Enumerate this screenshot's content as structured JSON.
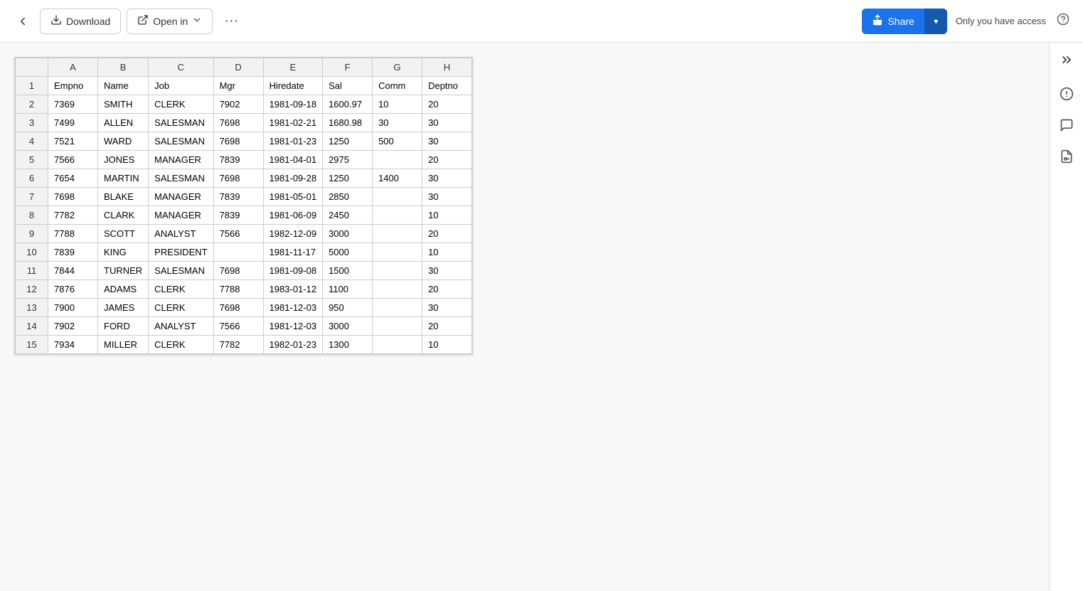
{
  "toolbar": {
    "back_label": "←",
    "download_label": "Download",
    "open_in_label": "Open in",
    "more_label": "•••",
    "share_label": "Share",
    "access_text": "Only you have access",
    "download_icon": "⬇",
    "open_in_icon": "↗",
    "share_icon": "↑"
  },
  "spreadsheet": {
    "col_headers": [
      "",
      "A",
      "B",
      "C",
      "D",
      "E",
      "F",
      "G",
      "H"
    ],
    "rows": [
      {
        "row": 1,
        "cells": [
          "Empno",
          "Name",
          "Job",
          "Mgr",
          "Hiredate",
          "Sal",
          "Comm",
          "Deptno"
        ]
      },
      {
        "row": 2,
        "cells": [
          "7369",
          "SMITH",
          "CLERK",
          "7902",
          "1981-09-18",
          "1600.97",
          "10",
          "20"
        ]
      },
      {
        "row": 3,
        "cells": [
          "7499",
          "ALLEN",
          "SALESMAN",
          "7698",
          "1981-02-21",
          "1680.98",
          "30",
          "30"
        ]
      },
      {
        "row": 4,
        "cells": [
          "7521",
          "WARD",
          "SALESMAN",
          "7698",
          "1981-01-23",
          "1250",
          "500",
          "30"
        ]
      },
      {
        "row": 5,
        "cells": [
          "7566",
          "JONES",
          "MANAGER",
          "7839",
          "1981-04-01",
          "2975",
          "",
          "20"
        ]
      },
      {
        "row": 6,
        "cells": [
          "7654",
          "MARTIN",
          "SALESMAN",
          "7698",
          "1981-09-28",
          "1250",
          "1400",
          "30"
        ]
      },
      {
        "row": 7,
        "cells": [
          "7698",
          "BLAKE",
          "MANAGER",
          "7839",
          "1981-05-01",
          "2850",
          "",
          "30"
        ]
      },
      {
        "row": 8,
        "cells": [
          "7782",
          "CLARK",
          "MANAGER",
          "7839",
          "1981-06-09",
          "2450",
          "",
          "10"
        ]
      },
      {
        "row": 9,
        "cells": [
          "7788",
          "SCOTT",
          "ANALYST",
          "7566",
          "1982-12-09",
          "3000",
          "",
          "20"
        ]
      },
      {
        "row": 10,
        "cells": [
          "7839",
          "KING",
          "PRESIDENT",
          "",
          "1981-11-17",
          "5000",
          "",
          "10"
        ]
      },
      {
        "row": 11,
        "cells": [
          "7844",
          "TURNER",
          "SALESMAN",
          "7698",
          "1981-09-08",
          "1500",
          "",
          "30"
        ]
      },
      {
        "row": 12,
        "cells": [
          "7876",
          "ADAMS",
          "CLERK",
          "7788",
          "1983-01-12",
          "1100",
          "",
          "20"
        ]
      },
      {
        "row": 13,
        "cells": [
          "7900",
          "JAMES",
          "CLERK",
          "7698",
          "1981-12-03",
          "950",
          "",
          "30"
        ]
      },
      {
        "row": 14,
        "cells": [
          "7902",
          "FORD",
          "ANALYST",
          "7566",
          "1981-12-03",
          "3000",
          "",
          "20"
        ]
      },
      {
        "row": 15,
        "cells": [
          "7934",
          "MILLER",
          "CLERK",
          "7782",
          "1982-01-23",
          "1300",
          "",
          "10"
        ]
      }
    ]
  }
}
